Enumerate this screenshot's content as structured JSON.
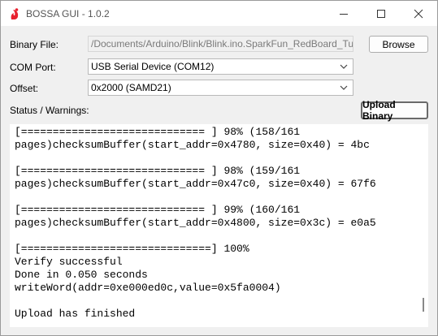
{
  "window": {
    "title": "BOSSA GUI - 1.0.2",
    "app_icon": "sparkfun-flame-icon",
    "accent": "#e8212e"
  },
  "form": {
    "binary_label": "Binary File:",
    "binary_value": "/Documents/Arduino/Blink/Blink.ino.SparkFun_RedBoard_Turbo.bin",
    "browse_label": "Browse",
    "port_label": "COM Port:",
    "port_value": "USB Serial Device (COM12)",
    "offset_label": "Offset:",
    "offset_value": "0x2000 (SAMD21)",
    "status_label": "Status / Warnings:",
    "upload_label": "Upload Binary"
  },
  "console": {
    "lines": [
      "[============================= ] 98% (158/161",
      "pages)checksumBuffer(start_addr=0x4780, size=0x40) = 4bc",
      "",
      "[============================= ] 98% (159/161",
      "pages)checksumBuffer(start_addr=0x47c0, size=0x40) = 67f6",
      "",
      "[============================= ] 99% (160/161",
      "pages)checksumBuffer(start_addr=0x4800, size=0x3c) = e0a5",
      "",
      "[==============================] 100%",
      "Verify successful",
      "Done in 0.050 seconds",
      "writeWord(addr=0xe000ed0c,value=0x5fa0004)",
      "",
      "Upload has finished"
    ]
  }
}
